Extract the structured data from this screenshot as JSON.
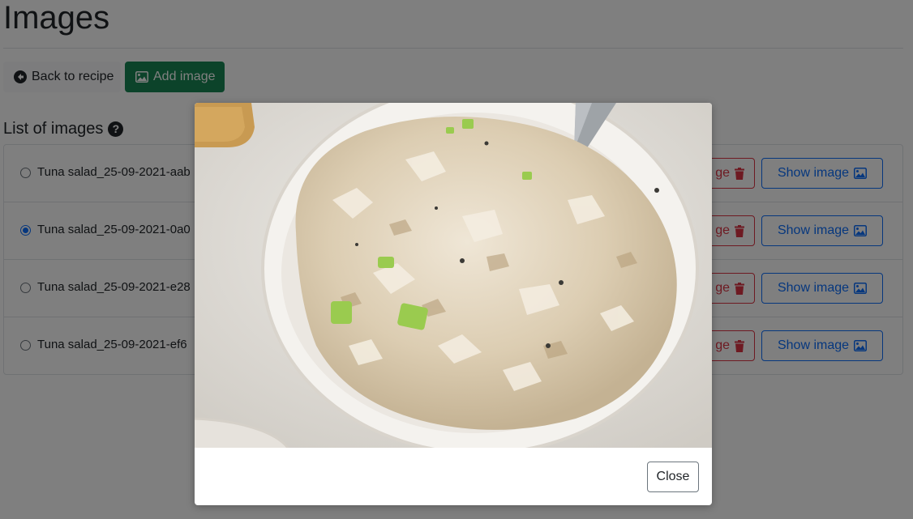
{
  "page": {
    "title": "Images"
  },
  "toolbar": {
    "back_label": "Back to recipe",
    "add_label": "Add image"
  },
  "list": {
    "heading": "List of images",
    "help_symbol": "?",
    "items": [
      {
        "name": "Tuna salad_25-09-2021-aab",
        "checked": false,
        "delete_label": "ge",
        "show_label": "Show image"
      },
      {
        "name": "Tuna salad_25-09-2021-0a0",
        "checked": true,
        "delete_label": "ge",
        "show_label": "Show image"
      },
      {
        "name": "Tuna salad_25-09-2021-e28",
        "checked": false,
        "delete_label": "ge",
        "show_label": "Show image"
      },
      {
        "name": "Tuna salad_25-09-2021-ef6",
        "checked": false,
        "delete_label": "ge",
        "show_label": "Show image"
      }
    ]
  },
  "modal": {
    "close_label": "Close"
  },
  "icons": {
    "back": "arrow-circle-left-icon",
    "add": "image-icon",
    "help": "question-circle-icon",
    "delete": "trash-icon",
    "show": "image-icon"
  },
  "colors": {
    "primary": "#0d6efd",
    "success": "#198754",
    "danger": "#dc3545",
    "backdrop": "rgba(0,0,0,0.5)"
  }
}
